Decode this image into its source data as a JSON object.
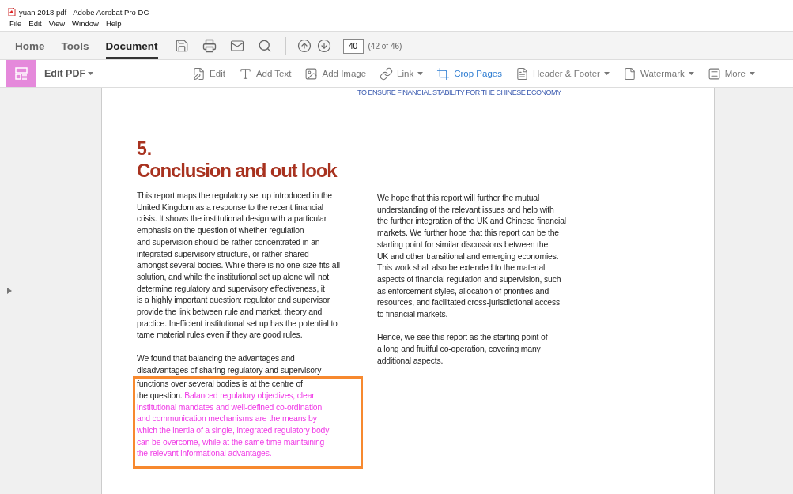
{
  "window": {
    "title": "yuan 2018.pdf - Adobe Acrobat Pro DC"
  },
  "menu": [
    "File",
    "Edit",
    "View",
    "Window",
    "Help"
  ],
  "tabs": [
    {
      "label": "Home",
      "selected": false
    },
    {
      "label": "Tools",
      "selected": false
    },
    {
      "label": "Document",
      "selected": true
    }
  ],
  "page_nav": {
    "value": "40",
    "count": "(42 of 46)"
  },
  "tool_panel": {
    "label": "Edit PDF"
  },
  "tools": [
    {
      "kind": "edit",
      "label": "Edit",
      "dropdown": false,
      "active": false
    },
    {
      "kind": "text",
      "label": "Add Text",
      "dropdown": false,
      "active": false
    },
    {
      "kind": "image",
      "label": "Add Image",
      "dropdown": false,
      "active": false
    },
    {
      "kind": "link",
      "label": "Link",
      "dropdown": true,
      "active": false
    },
    {
      "kind": "crop",
      "label": "Crop Pages",
      "dropdown": false,
      "active": true
    },
    {
      "kind": "header",
      "label": "Header & Footer",
      "dropdown": true,
      "active": false
    },
    {
      "kind": "watermark",
      "label": "Watermark",
      "dropdown": true,
      "active": false
    },
    {
      "kind": "more",
      "label": "More",
      "dropdown": true,
      "active": false
    }
  ],
  "document": {
    "running_header": "TO ENSURE FINANCIAL STABILITY FOR THE CHINESE ECONOMY",
    "section_number": "5.",
    "heading": "Conclusion and out look",
    "left_column": [
      {
        "lines": [
          "This report maps the regulatory set up introduced in the",
          "United Kingdom as a response to the recent financial",
          "crisis. It shows the institutional design with a particular",
          "emphasis on the question of whether regulation",
          "and supervision should be rather concentrated in an",
          "integrated supervisory structure, or rather shared",
          "amongst several bodies. While there is no one-size-fits-all",
          "solution, and while the institutional set up alone will not",
          "determine regulatory and supervisory effectiveness, it",
          "is a highly important question: regulator and supervisor",
          "provide the link between rule and market, theory and",
          "practice. Inefficient institutional set up has the potential to",
          "tame material rules even if they are good rules."
        ]
      },
      {
        "lines": [
          "We found that balancing the advantages and",
          "disadvantages of sharing regulatory and supervisory"
        ],
        "boxed_lines": [
          {
            "plain": "functions over several bodies is at the centre of"
          },
          {
            "plain": "the question.",
            "highlighted": "Balanced regulatory objectives, clear"
          },
          {
            "highlighted": "institutional mandates and well-defined co-ordination"
          },
          {
            "highlighted": "and communication mechanisms are the means by"
          },
          {
            "highlighted": "which the inertia of a single, integrated regulatory body"
          },
          {
            "highlighted": "can be overcome, while at the same time maintaining"
          },
          {
            "highlighted": "the relevant informational advantages."
          }
        ]
      }
    ],
    "right_column": [
      {
        "lines": [
          "We hope that this report will further the mutual",
          "understanding of the relevant issues and help with",
          "the further integration of the UK and Chinese financial",
          "markets. We further hope that this report can be the",
          "starting point for similar discussions between the",
          "UK and other transitional and emerging economies.",
          "This work shall also be extended to the material",
          "aspects of financial regulation and supervision, such",
          "as enforcement styles, allocation of priorities and",
          "resources, and facilitated cross-jurisdictional access",
          "to financial markets."
        ]
      },
      {
        "lines": [
          "Hence, we see this report as the starting point of",
          "a long and fruitful co-operation, covering many",
          "additional aspects."
        ]
      }
    ]
  }
}
